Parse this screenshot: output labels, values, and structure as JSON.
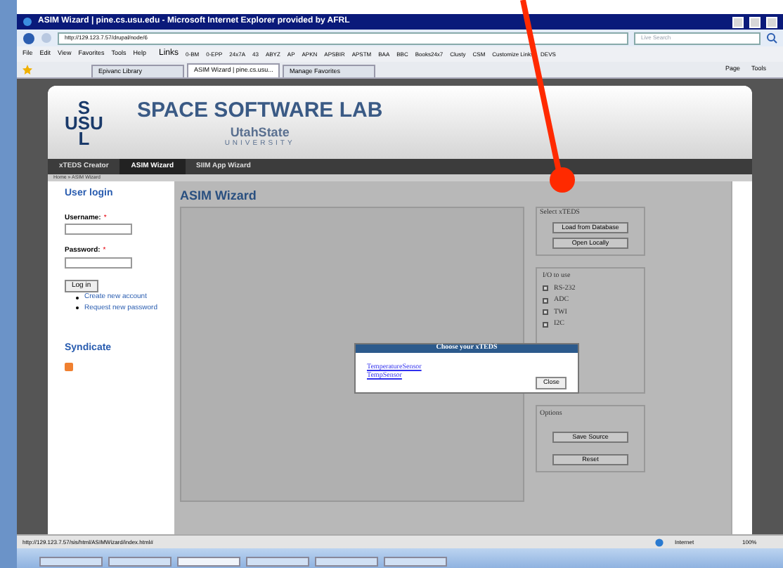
{
  "window": {
    "title": "ASIM Wizard | pine.cs.usu.edu - Microsoft Internet Explorer provided by AFRL"
  },
  "address_bar": {
    "url": "http://129.123.7.57/drupal/node/6"
  },
  "search": {
    "placeholder": "Live Search"
  },
  "menu": [
    "File",
    "Edit",
    "View",
    "Favorites",
    "Tools",
    "Help"
  ],
  "links_label": "Links",
  "links": [
    "0-BM",
    "0-EPP",
    "24x7A",
    "43",
    "ABYZ",
    "AP",
    "APKN",
    "APSBIR",
    "APSTM",
    "BAA",
    "BBC",
    "Books24x7",
    "Clusty",
    "CSM",
    "Customize Links",
    "DEVS"
  ],
  "tabs": [
    {
      "label": "Epivanc Library",
      "selected": false
    },
    {
      "label": "ASIM Wizard | pine.cs.usu...",
      "selected": true
    },
    {
      "label": "Manage Favorites",
      "selected": false
    }
  ],
  "command_bar": [
    "Page",
    "Tools"
  ],
  "site": {
    "logo": [
      "S",
      "USU",
      "L"
    ],
    "title": "SPACE SOFTWARE LAB",
    "subtitle": "UtahState",
    "subtitle2": "UNIVERSITY"
  },
  "nav": [
    {
      "label": "xTEDS Creator",
      "selected": false
    },
    {
      "label": "ASIM Wizard",
      "selected": true
    },
    {
      "label": "SIIM App Wizard",
      "selected": false
    }
  ],
  "breadcrumb": "Home » ASIM Wizard",
  "login": {
    "heading": "User login",
    "username_label": "Username:",
    "password_label": "Password:",
    "required_mark": "*",
    "button": "Log in",
    "links": [
      "Create new account",
      "Request new password"
    ]
  },
  "syndicate": "Syndicate",
  "main_heading": "ASIM Wizard",
  "select_xteds": {
    "legend": "Select xTEDS",
    "buttons": [
      "Load from Database",
      "Open Locally"
    ]
  },
  "io": {
    "legend": "I/O to use",
    "options": [
      {
        "label": "RS-232",
        "checked": false
      },
      {
        "label": "ADC",
        "checked": false
      },
      {
        "label": "TWI",
        "checked": false
      },
      {
        "label": "I2C",
        "checked": false
      }
    ]
  },
  "options": {
    "legend": "Options",
    "buttons": [
      "Save Source",
      "Reset"
    ]
  },
  "dialog": {
    "title": "Choose your xTEDS",
    "links": [
      "TemperatureSensor",
      "TempSensor"
    ],
    "button": "Close"
  },
  "status_bar": {
    "url": "http://129.123.7.57/sis/html/ASIMWizard/index.html#",
    "zone": "Internet",
    "zoom": "100%"
  }
}
